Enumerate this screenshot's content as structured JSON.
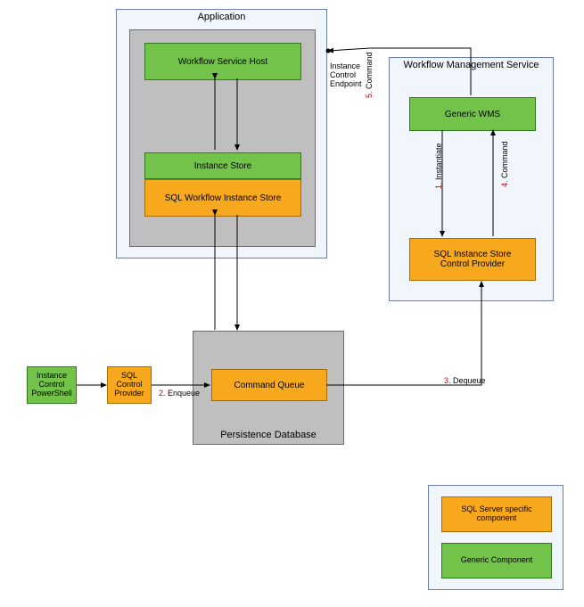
{
  "application": {
    "title": "Application",
    "workflow_service_host": "Workflow Service Host",
    "instance_store": "Instance Store",
    "sql_workflow_instance_store": "SQL Workflow Instance Store",
    "instance_control_endpoint": "Instance\nControl\nEndpoint"
  },
  "wms": {
    "title": "Workflow Management Service",
    "generic_wms": "Generic WMS",
    "sql_instance_store_control_provider": "SQL Instance Store\nControl Provider"
  },
  "powershell": {
    "instance_control_powershell": "Instance\nControl\nPowerShell",
    "sql_control_provider": "SQL\nControl\nProvider"
  },
  "persistence": {
    "title": "Persistence Database",
    "command_queue": "Command Queue"
  },
  "flows": {
    "step1_num": "1.",
    "step1_txt": "Instantiate",
    "step2_num": "2.",
    "step2_txt": "Enqueue",
    "step3_num": "3.",
    "step3_txt": "Dequeue",
    "step4_num": "4.",
    "step4_txt": "Command",
    "step5_num": "5.",
    "step5_txt": "Command"
  },
  "legend": {
    "sql_specific": "SQL Server specific\ncomponent",
    "generic": "Generic Component"
  }
}
